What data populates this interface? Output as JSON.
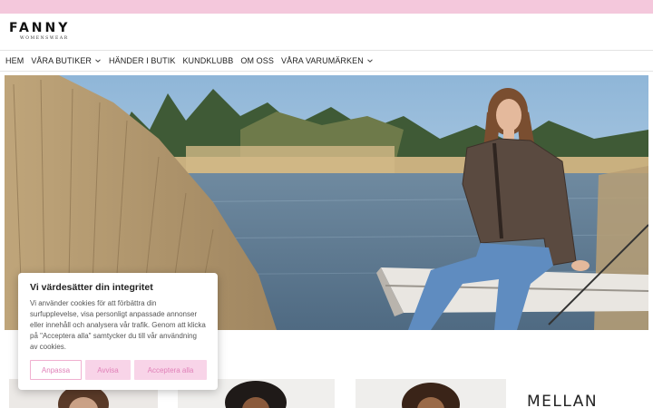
{
  "brand": {
    "name": "FANNY",
    "tagline": "WOMENSWEAR"
  },
  "nav": {
    "items": [
      {
        "label": "HEM",
        "has_dropdown": false
      },
      {
        "label": "VÅRA BUTIKER",
        "has_dropdown": true
      },
      {
        "label": "HÄNDER I BUTIK",
        "has_dropdown": false
      },
      {
        "label": "KUNDKLUBB",
        "has_dropdown": false
      },
      {
        "label": "OM OSS",
        "has_dropdown": false
      },
      {
        "label": "VÅRA VARUMÄRKEN",
        "has_dropdown": true
      }
    ]
  },
  "cookie": {
    "title": "Vi värdesätter din integritet",
    "text": "Vi använder cookies för att förbättra din surfupplevelse, visa personligt anpassade annonser eller innehåll och analysera vår trafik. Genom att klicka på \"Acceptera alla\" samtycker du till vår användning av cookies.",
    "customize_label": "Anpassa",
    "reject_label": "Avvisa",
    "accept_label": "Acceptera alla"
  },
  "section": {
    "heading": "MELLAN"
  },
  "colors": {
    "topbar": "#f4c8dc",
    "accent": "#e080b8",
    "button_bg": "#f8d4e8"
  }
}
